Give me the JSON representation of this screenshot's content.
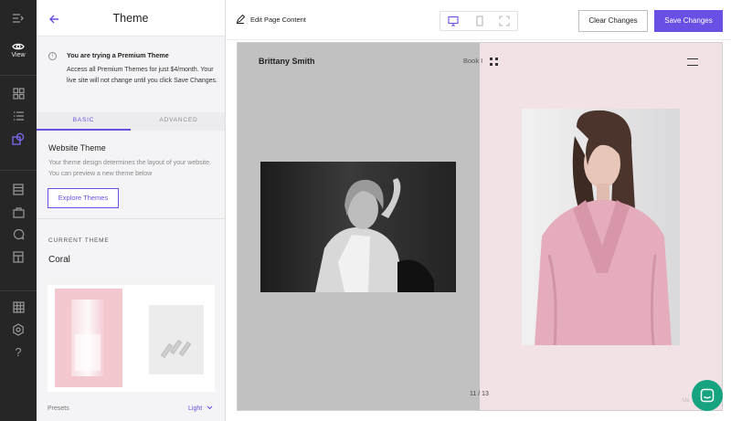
{
  "rail": {
    "items": [
      {
        "icon": "menu-expand-icon"
      },
      {
        "icon": "eye-icon",
        "label": "View"
      },
      {
        "icon": "grid-icon"
      },
      {
        "icon": "list-icon"
      },
      {
        "icon": "shapes-icon"
      },
      {
        "icon": "table-icon"
      },
      {
        "icon": "bag-icon"
      },
      {
        "icon": "chat-bubble-icon"
      },
      {
        "icon": "page-icon"
      },
      {
        "icon": "apps-icon"
      },
      {
        "icon": "settings-icon"
      },
      {
        "icon": "help-icon",
        "glyph": "?"
      }
    ]
  },
  "panel": {
    "title": "Theme",
    "notice": {
      "title": "You are trying a Premium Theme",
      "body": "Access all Premium Themes for just $4/month. Your live site will not change until you click Save Changes."
    },
    "tabs": {
      "basic": "BASIC",
      "advanced": "ADVANCED"
    },
    "website_theme": {
      "heading": "Website Theme",
      "description": "Your theme design determines the layout of your website. You can preview a new theme below",
      "button": "Explore Themes"
    },
    "current_theme_label": "CURRENT THEME",
    "current_theme_name": "Coral",
    "presets_label": "Presets",
    "presets_value": "Light"
  },
  "toolbar": {
    "edit_label": "Edit Page Content",
    "clear_label": "Clear Changes",
    "save_label": "Save Changes"
  },
  "preview": {
    "brand": "Brittany Smith",
    "nav_partial": "Book I",
    "counter": "11 / 13",
    "footer_partial": "Us"
  },
  "colors": {
    "accent": "#6a4fe4",
    "rail_bg": "#262626",
    "preview_left": "#c1c1c1",
    "preview_right": "#f2e2e6",
    "chat": "#16a37f"
  }
}
